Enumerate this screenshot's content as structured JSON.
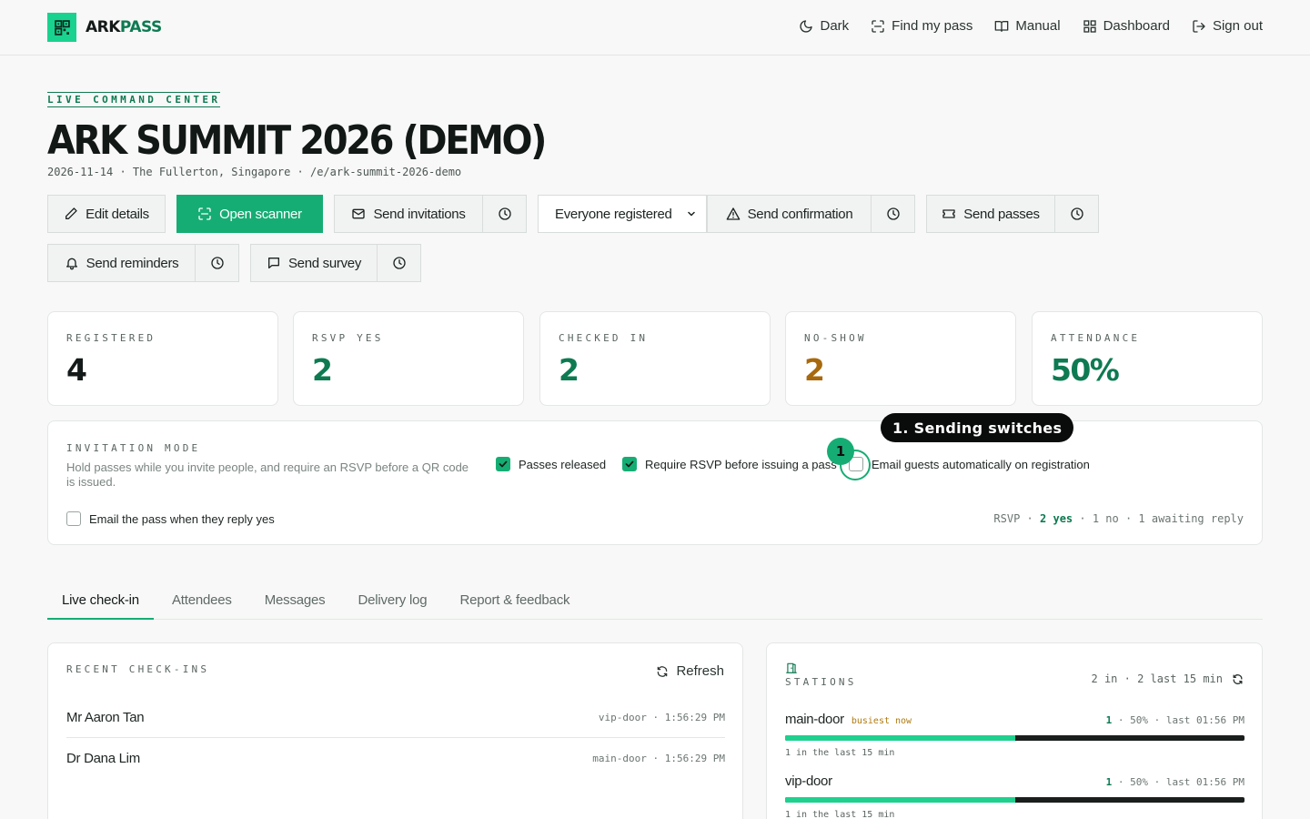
{
  "brand": {
    "part1": "ARK",
    "part2": "PASS"
  },
  "nav": [
    {
      "label": "Dark",
      "icon": "moon-icon"
    },
    {
      "label": "Find my pass",
      "icon": "scan-icon"
    },
    {
      "label": "Manual",
      "icon": "book-icon"
    },
    {
      "label": "Dashboard",
      "icon": "grid-icon"
    },
    {
      "label": "Sign out",
      "icon": "logout-icon"
    }
  ],
  "hero": {
    "eyebrow": "LIVE COMMAND CENTER",
    "title": "ARK SUMMIT 2026 (DEMO)",
    "meta": "2026-11-14 · The Fullerton, Singapore · /e/ark-summit-2026-demo"
  },
  "actions": {
    "edit": "Edit details",
    "scanner": "Open scanner",
    "invitations": "Send invitations",
    "audience": "Everyone registered",
    "confirmation": "Send confirmation",
    "passes": "Send passes",
    "reminders": "Send reminders",
    "survey": "Send survey"
  },
  "stats": [
    {
      "label": "REGISTERED",
      "value": "4",
      "color": "#141a19"
    },
    {
      "label": "RSVP YES",
      "value": "2",
      "color": "#0e7a52"
    },
    {
      "label": "CHECKED IN",
      "value": "2",
      "color": "#0e7a52"
    },
    {
      "label": "NO-SHOW",
      "value": "2",
      "color": "#a8690d"
    },
    {
      "label": "ATTENDANCE",
      "value": "50%",
      "color": "#0e7a52"
    }
  ],
  "invitation": {
    "label": "INVITATION MODE",
    "description": "Hold passes while you invite people, and require an RSVP before a QR code is issued.",
    "options": [
      {
        "label": "Passes released",
        "checked": true
      },
      {
        "label": "Require RSVP before issuing a pass",
        "checked": true
      },
      {
        "label": "Email guests automatically on registration",
        "checked": false
      },
      {
        "label": "Email the pass when they reply yes",
        "checked": false
      }
    ],
    "rsvp": {
      "prefix": "RSVP ·",
      "yes": "2 yes",
      "rest": "· 1 no · 1 awaiting reply"
    }
  },
  "annotation": {
    "number": "1",
    "label": "1. Sending switches"
  },
  "tabs": [
    "Live check-in",
    "Attendees",
    "Messages",
    "Delivery log",
    "Report & feedback"
  ],
  "recent": {
    "label": "RECENT CHECK-INS",
    "refresh": "Refresh",
    "rows": [
      {
        "name": "Mr Aaron Tan",
        "meta": "vip-door · 1:56:29 PM"
      },
      {
        "name": "Dr Dana Lim",
        "meta": "main-door · 1:56:29 PM"
      }
    ]
  },
  "stations": {
    "label": "STATIONS",
    "summary": "2 in · 2 last 15 min",
    "items": [
      {
        "name": "main-door",
        "badge": "busiest now",
        "count": "1",
        "stats": "· 50% · last 01:56 PM",
        "share": 0.5,
        "sub": "1 in the last 15 min"
      },
      {
        "name": "vip-door",
        "badge": "",
        "count": "1",
        "stats": "· 50% · last 01:56 PM",
        "share": 0.5,
        "sub": "1 in the last 15 min"
      }
    ]
  }
}
